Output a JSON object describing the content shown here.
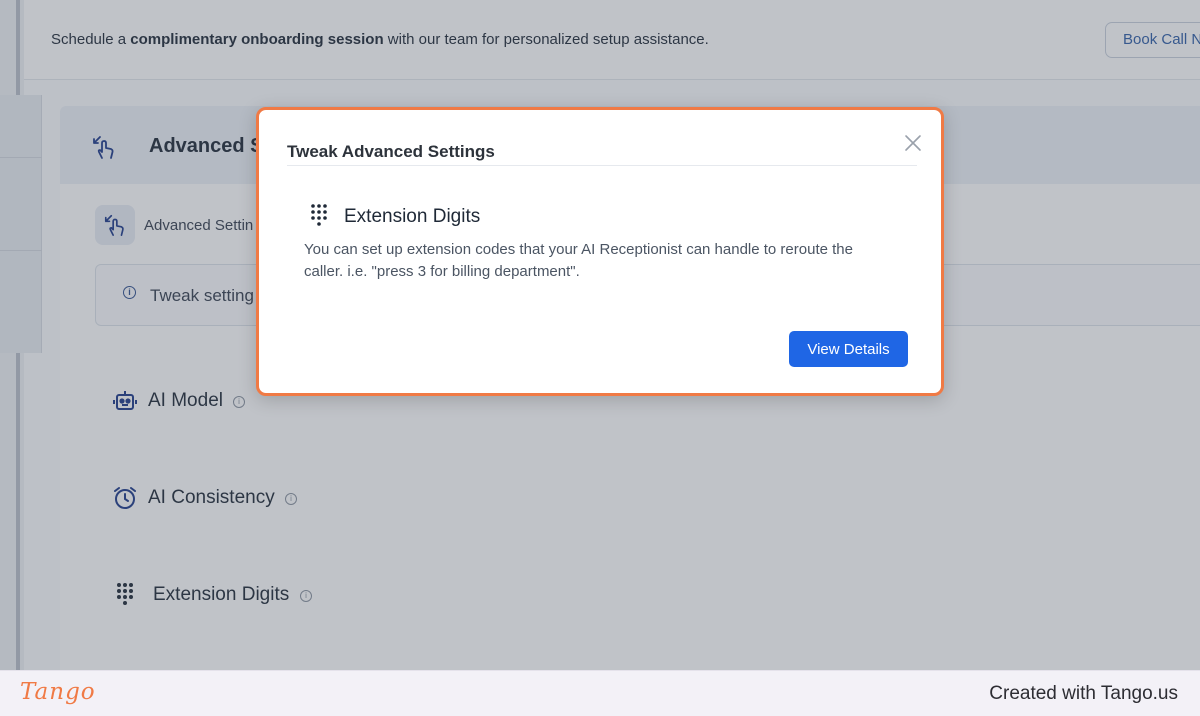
{
  "banner": {
    "text_before": "Schedule a ",
    "text_bold": "complimentary onboarding session",
    "text_after": " with our team for personalized setup assistance.",
    "book_call_label": "Book Call N"
  },
  "card": {
    "title": "Advanced S",
    "sub_label": "Advanced Settin",
    "info_text": "Tweak setting"
  },
  "settings": [
    {
      "label": "AI Model",
      "icon": "robot-icon"
    },
    {
      "label": "AI Consistency",
      "icon": "alarm-clock-icon"
    },
    {
      "label": "Extension Digits",
      "icon": "dialpad-icon"
    }
  ],
  "modal": {
    "title": "Tweak Advanced Settings",
    "feature_title": "Extension Digits",
    "feature_description": "You can set up extension codes that your AI Receptionist can handle to reroute the caller. i.e. \"press 3 for billing department\".",
    "button_label": "View Details"
  },
  "footer": {
    "logo": "Tango",
    "credit": "Created with Tango.us"
  },
  "colors": {
    "accent_orange": "#f07a45",
    "button_blue": "#1f66e5",
    "icon_navy": "#1e3a8a"
  }
}
